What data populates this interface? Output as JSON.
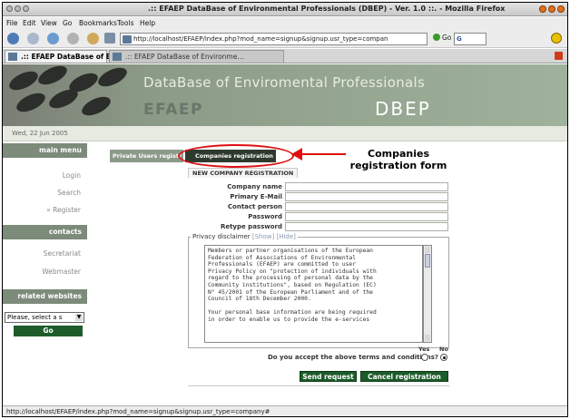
{
  "window": {
    "title": ".:: EFAEP DataBase of Environmental Professionals (DBEP) - Ver. 1.0 ::. - Mozilla Firefox"
  },
  "menubar": [
    "File",
    "Edit",
    "View",
    "Go",
    "Bookmarks",
    "Tools",
    "Help"
  ],
  "navbar": {
    "url": "http://localhost/EFAEP/index.php?mod_name=signup&signup.usr_type=compan",
    "go_label": "Go",
    "search_value": "G"
  },
  "tabs": [
    {
      "label": ".:: EFAEP DataBase of Envir...",
      "active": true
    },
    {
      "label": ".:: EFAEP DataBase of Environme...",
      "active": false
    }
  ],
  "banner": {
    "title": "DataBase of Enviromental Professionals",
    "logo": "EFAEP",
    "short": "DBEP"
  },
  "date": "Wed, 22 Jun 2005",
  "sidebar": {
    "main_menu": {
      "heading": "main menu",
      "items": [
        "Login",
        "Search",
        "» Register"
      ]
    },
    "contacts": {
      "heading": "contacts",
      "items": [
        "Secretariat",
        "Webmaster"
      ]
    },
    "related": {
      "heading": "related websites",
      "select_value": "Please, select a s",
      "go_label": "Go"
    }
  },
  "form_tabs": {
    "private": "Private Users registr",
    "company": "Companies registration"
  },
  "annotation": "Companies registration form",
  "form": {
    "heading": "NEW COMPANY REGISTRATION",
    "fields": [
      "Company name",
      "Primary E-Mail",
      "Contact person",
      "Password",
      "Retype password"
    ],
    "privacy": {
      "legend": "Privacy disclaimer",
      "show_label": "[Show]",
      "hide_label": "[Hide]",
      "text": "Members or partner organisations of the European\nFederation of Associations of Environmental\nProfessionals (EFAEP) are committed to user\nPrivacy Policy on \"protection of individuals with\nregard to the processing of personal data by the\nCommunity institutions\", based on Regulation (EC)\nN° 45/2001 of the European Parliament and of the\nCouncil of 18th December 2000.\n\nYour personal base information are being required\nin order to enable us to provide the e-services"
    },
    "terms_question": "Do you accept the above terms and conditions?",
    "yes_label": "Yes",
    "no_label": "No",
    "send_label": "Send request",
    "cancel_label": "Cancel registration"
  },
  "status": "http://localhost/EFAEP/index.php?mod_name=signup&signup.usr_type=company#"
}
